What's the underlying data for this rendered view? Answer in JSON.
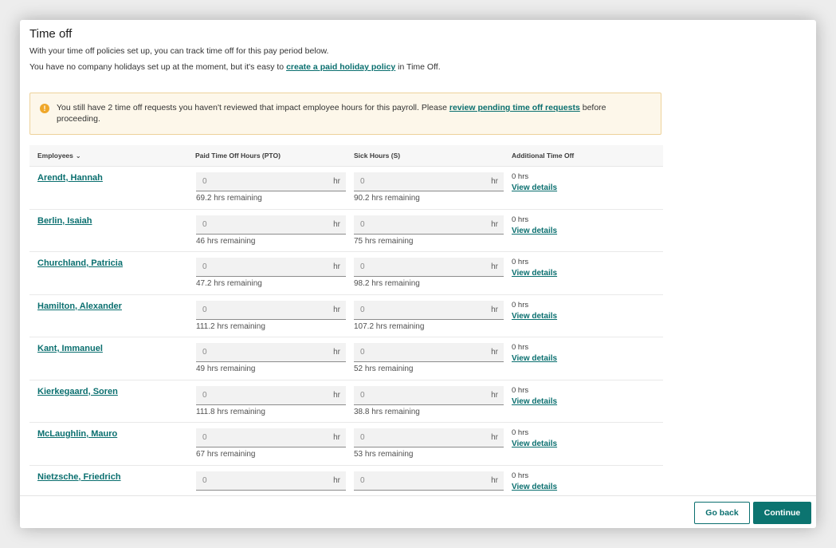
{
  "page": {
    "title": "Time off",
    "intro_line1": "With your time off policies set up, you can track time off for this pay period below.",
    "intro_line2_prefix": "You have no company holidays set up at the moment, but it's easy to",
    "intro_line2_link": "create a paid holiday policy",
    "intro_line2_suffix": "in Time Off."
  },
  "alert": {
    "icon": "warning-icon",
    "icon_glyph": "!",
    "text_prefix": "You still have 2 time off requests you haven't reviewed that impact employee hours for this payroll. Please",
    "link": "review pending time off requests",
    "text_suffix": "before proceeding."
  },
  "table": {
    "headers": {
      "employees": "Employees",
      "employees_sort_icon": "chevron-down-icon",
      "pto": "Paid Time Off Hours (PTO)",
      "sick": "Sick Hours (S)",
      "additional": "Additional Time Off"
    },
    "unit": "hr",
    "view_details_label": "View details",
    "rows": [
      {
        "name": "Arendt, Hannah",
        "pto_value": "0",
        "pto_remaining": "69.2 hrs remaining",
        "sick_value": "0",
        "sick_remaining": "90.2 hrs remaining",
        "additional": "0 hrs"
      },
      {
        "name": "Berlin, Isaiah",
        "pto_value": "0",
        "pto_remaining": "46 hrs remaining",
        "sick_value": "0",
        "sick_remaining": "75 hrs remaining",
        "additional": "0 hrs"
      },
      {
        "name": "Churchland, Patricia",
        "pto_value": "0",
        "pto_remaining": "47.2 hrs remaining",
        "sick_value": "0",
        "sick_remaining": "98.2 hrs remaining",
        "additional": "0 hrs"
      },
      {
        "name": "Hamilton, Alexander",
        "pto_value": "0",
        "pto_remaining": "111.2 hrs remaining",
        "sick_value": "0",
        "sick_remaining": "107.2 hrs remaining",
        "additional": "0 hrs"
      },
      {
        "name": "Kant, Immanuel",
        "pto_value": "0",
        "pto_remaining": "49 hrs remaining",
        "sick_value": "0",
        "sick_remaining": "52 hrs remaining",
        "additional": "0 hrs"
      },
      {
        "name": "Kierkegaard, Soren",
        "pto_value": "0",
        "pto_remaining": "111.8 hrs remaining",
        "sick_value": "0",
        "sick_remaining": "38.8 hrs remaining",
        "additional": "0 hrs"
      },
      {
        "name": "McLaughlin, Mauro",
        "pto_value": "0",
        "pto_remaining": "67 hrs remaining",
        "sick_value": "0",
        "sick_remaining": "53 hrs remaining",
        "additional": "0 hrs"
      },
      {
        "name": "Nietzsche, Friedrich",
        "pto_value": "0",
        "pto_remaining": "",
        "sick_value": "0",
        "sick_remaining": "",
        "additional": "0 hrs"
      }
    ]
  },
  "footer": {
    "back_label": "Go back",
    "continue_label": "Continue"
  },
  "colors": {
    "accent": "#0c7470",
    "link": "#0a6f6f",
    "alert_bg": "#fdf7ea",
    "alert_border": "#edd29b",
    "alert_icon": "#efa72a"
  }
}
